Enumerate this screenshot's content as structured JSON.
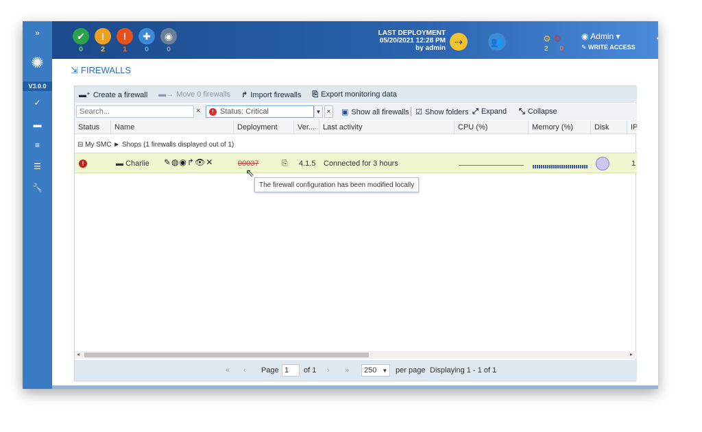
{
  "sidebar": {
    "expand_glyph": "»",
    "version": "V3.0.0",
    "items": [
      "check-circle-icon",
      "firewall-icon",
      "database-icon",
      "list-icon",
      "wrench-icon"
    ]
  },
  "header": {
    "status": [
      {
        "glyph": "✔",
        "count": "0",
        "color": "#2aa34a",
        "count_color": "#5fd37a"
      },
      {
        "glyph": "!",
        "count": "2",
        "color": "#f0a020",
        "count_color": "#f6c04a"
      },
      {
        "glyph": "!",
        "count": "1",
        "color": "#e8501a",
        "count_color": "#f0704a"
      },
      {
        "glyph": "✚",
        "count": "0",
        "color": "#3a8ad6",
        "count_color": "#6aaae6"
      },
      {
        "glyph": "◉",
        "count": "0",
        "color": "#6a7f99",
        "count_color": "#8fa1b6"
      }
    ],
    "deployment_label": "LAST DEPLOYMENT",
    "deployment_date": "05/20/2021 12:28 PM",
    "deployment_by": "by admin",
    "alert_counts": [
      "2",
      "0"
    ],
    "user": "Admin ▾",
    "access": "WRITE ACCESS",
    "help": "?"
  },
  "page": {
    "title": "FIREWALLS"
  },
  "toolbar": {
    "create": "Create a firewall",
    "move": "Move 0 firewalls",
    "import": "Import firewalls",
    "export": "Export monitoring data"
  },
  "filters": {
    "search_placeholder": "Search...",
    "clear": "×",
    "status": "Status: Critical",
    "show_all": "Show all firewalls",
    "show_folders": "Show folders",
    "expand": "Expand",
    "collapse": "Collapse"
  },
  "columns": [
    "Status",
    "Name",
    "Deployment",
    "Ver...",
    "Last activity",
    "CPU (%)",
    "Memory (%)",
    "Disk",
    "IP"
  ],
  "group": "⊟ My SMC ► Shops (1 firewalls displayed out of 1)",
  "rows": [
    {
      "name": "Charlie",
      "deployment": "00037",
      "version": "4.1.5",
      "activity": "Connected for 3 hours",
      "ip_partial": "1"
    }
  ],
  "tooltip": "The firewall configuration has been modified locally",
  "pager": {
    "page_label": "Page",
    "page_value": "1",
    "of": "of 1",
    "page_size": "250",
    "per_page": "per page",
    "displaying": "Displaying 1 - 1 of 1"
  }
}
